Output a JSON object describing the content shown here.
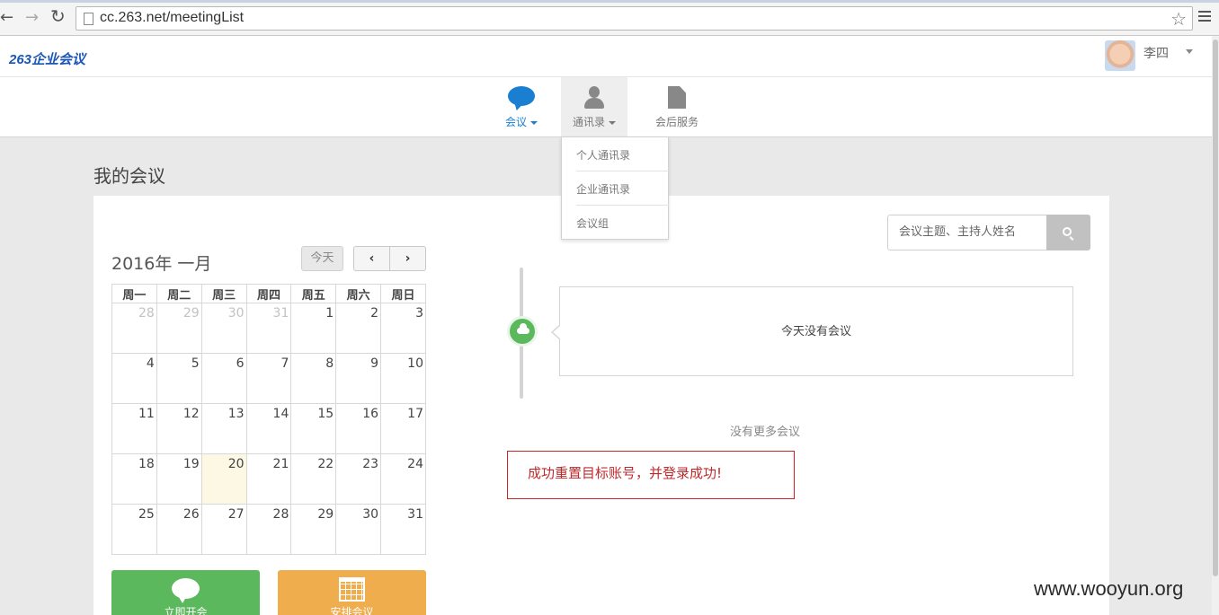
{
  "browser": {
    "back": "←",
    "forward": "→",
    "reload": "↻",
    "url": "cc.263.net/meetingList",
    "star": "☆"
  },
  "header": {
    "logo": "263企业会议",
    "user_name": "李四"
  },
  "nav": {
    "items": [
      {
        "label": "会议",
        "icon": "chat-bubble-icon",
        "active": true
      },
      {
        "label": "通讯录",
        "icon": "person-icon",
        "open": true
      },
      {
        "label": "会后服务",
        "icon": "document-icon"
      }
    ],
    "dropdown": [
      "个人通讯录",
      "企业通讯录",
      "会议组"
    ]
  },
  "page": {
    "title": "我的会议"
  },
  "calendar": {
    "title": "2016年 一月",
    "today_label": "今天",
    "prev": "‹",
    "next": "›",
    "weekdays": [
      "周一",
      "周二",
      "周三",
      "周四",
      "周五",
      "周六",
      "周日"
    ],
    "weeks": [
      [
        "28",
        "29",
        "30",
        "31",
        "1",
        "2",
        "3"
      ],
      [
        "4",
        "5",
        "6",
        "7",
        "8",
        "9",
        "10"
      ],
      [
        "11",
        "12",
        "13",
        "14",
        "15",
        "16",
        "17"
      ],
      [
        "18",
        "19",
        "20",
        "21",
        "22",
        "23",
        "24"
      ],
      [
        "25",
        "26",
        "27",
        "28",
        "29",
        "30",
        "31"
      ]
    ],
    "other_month_count": 4,
    "today": "20"
  },
  "actions": {
    "start_now": "立即开会",
    "schedule": "安排会议"
  },
  "search": {
    "placeholder": "会议主题、主持人姓名"
  },
  "timeline": {
    "no_meeting_today": "今天没有会议",
    "no_more": "没有更多会议"
  },
  "annotation": "成功重置目标账号，并登录成功!",
  "watermark": "www.wooyun.org",
  "colors": {
    "primary_blue": "#1a7fd0",
    "green": "#5cb85c",
    "orange": "#f0ad4e",
    "annotation_red": "#cc2222"
  }
}
